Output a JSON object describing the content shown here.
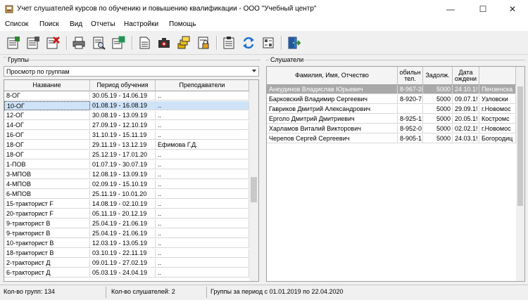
{
  "window": {
    "title": "Учет слушателей курсов по обучению и повышению квалификации - ООО \"Учебный центр\"",
    "minimize": "—",
    "maximize": "☐",
    "close": "✕"
  },
  "menu": [
    "Список",
    "Поиск",
    "Вид",
    "Отчеты",
    "Настройки",
    "Помощь"
  ],
  "groups_panel": {
    "label": "Группы",
    "view_mode": "Просмотр по группам",
    "columns": [
      "Название",
      "Период обучения",
      "Преподаватели"
    ],
    "rows": [
      {
        "name": "8-ОГ",
        "period": "30.05.19 - 14.06.19",
        "teachers": ".."
      },
      {
        "name": "10-ОГ",
        "period": "01.08.19 - 16.08.19",
        "teachers": ".."
      },
      {
        "name": "12-ОГ",
        "period": "30.08.19 - 13.09.19",
        "teachers": ".."
      },
      {
        "name": "14-ОГ",
        "period": "27.09.19 - 12.10.19",
        "teachers": ".."
      },
      {
        "name": "16-ОГ",
        "period": "31.10.19 - 15.11.19",
        "teachers": ".."
      },
      {
        "name": "18-ОГ",
        "period": "29.11.19 - 13.12.19",
        "teachers": "Ефимова Г.Д."
      },
      {
        "name": "18-ОГ",
        "period": "25.12.19 - 17.01.20",
        "teachers": ".."
      },
      {
        "name": "1-ПОВ",
        "period": "01.07.19 - 30.07.19",
        "teachers": ".."
      },
      {
        "name": "3-МПОВ",
        "period": "12.08.19 - 13.09.19",
        "teachers": ".."
      },
      {
        "name": "4-МПОВ",
        "period": "02.09.19 - 15.10.19",
        "teachers": ".."
      },
      {
        "name": "6-МПОВ",
        "period": "25.11.19 - 10.01.20",
        "teachers": ".."
      },
      {
        "name": "15-тракторист F",
        "period": "14.08.19 - 02.10.19",
        "teachers": ".."
      },
      {
        "name": "20-тракторист F",
        "period": "05.11.19 - 20.12.19",
        "teachers": ".."
      },
      {
        "name": "9-тракторист В",
        "period": "25.04.19 - 21.06.19",
        "teachers": ".."
      },
      {
        "name": "9-тракторист В",
        "period": "25.04.19 - 21.06.19",
        "teachers": ".."
      },
      {
        "name": "10-тракторист В",
        "period": "12.03.19 - 13.05.19",
        "teachers": ".."
      },
      {
        "name": "18-тракторист В",
        "period": "03.10.19 - 22.11.19",
        "teachers": ".."
      },
      {
        "name": "2-тракторист Д",
        "period": "09.01.19 - 27.02.19",
        "teachers": ".."
      },
      {
        "name": "6-тракторист Д",
        "period": "05.03.19 - 24.04.19",
        "teachers": ".."
      }
    ]
  },
  "students_panel": {
    "label": "Слушатели",
    "columns": [
      "Фамилия, Имя, Отчество",
      "обильн\nтел.",
      "Задолж.",
      "Дата\nождени",
      ""
    ],
    "rows": [
      {
        "fio": "Анкудинов Владислав Юрьевич",
        "phone": "8-967-2(",
        "debt": "5000",
        "dob": "24.10.1!",
        "addr": "Пензенска"
      },
      {
        "fio": "Барковский Владимир Сергеевич",
        "phone": "8-920-7:",
        "debt": "5000",
        "dob": "09.07.1!",
        "addr": "Узловски"
      },
      {
        "fio": "Гавриков Дмитрий Александрович",
        "phone": "",
        "debt": "5000",
        "dob": "29.09.1!",
        "addr": "г.Новомос"
      },
      {
        "fio": "Ерголо Дмитрий Дмитриевич",
        "phone": "8-925-1:",
        "debt": "5000",
        "dob": "20.05.1!",
        "addr": "Костромс"
      },
      {
        "fio": "Харламов Виталий Викторович",
        "phone": "8-952-0",
        "debt": "5000",
        "dob": "02.02.1!",
        "addr": "г.Новомос"
      },
      {
        "fio": "Черепов Сергей Сергеевич",
        "phone": "8-905-1",
        "debt": "5000",
        "dob": "24.03.1!",
        "addr": "Богородиц"
      }
    ]
  },
  "status": {
    "groups_count": "Кол-во групп: 134",
    "students_count": "Кол-во слушателей: 2",
    "period": "Группы за период с 01.01.2019 по 22.04.2020"
  }
}
